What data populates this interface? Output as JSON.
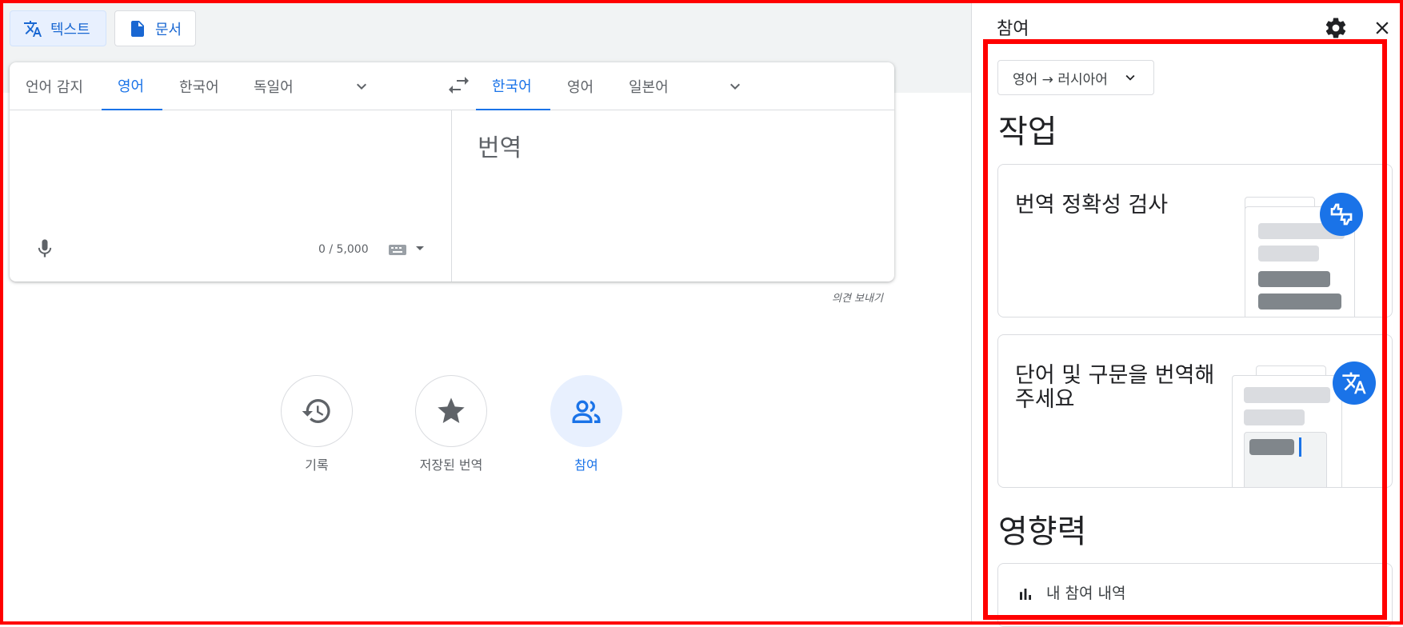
{
  "toolbar": {
    "text_mode_label": "텍스트",
    "doc_mode_label": "문서"
  },
  "source_langs": {
    "detect": "언어 감지",
    "english": "영어",
    "korean": "한국어",
    "german": "독일어"
  },
  "target_langs": {
    "korean": "한국어",
    "english": "영어",
    "japanese": "일본어"
  },
  "input": {
    "char_count": "0 / 5,000"
  },
  "output": {
    "placeholder": "번역"
  },
  "feedback_link": "의견 보내기",
  "bottom_actions": {
    "history": "기록",
    "saved": "저장된 번역",
    "contribute": "참여"
  },
  "panel": {
    "title": "참여",
    "lang_pair": "영어 → 러시아어",
    "tasks_heading": "작업",
    "task_verify": "번역 정확성 검사",
    "task_translate": "단어 및 구문을 번역해 주세요",
    "impact_heading": "영향력",
    "my_contributions": "내 참여 내역"
  },
  "colors": {
    "accent": "#1a73e8",
    "highlight_border": "#ff0000"
  },
  "icons": [
    "translate-icon",
    "document-icon",
    "chevron-down-icon",
    "swap-icon",
    "mic-icon",
    "keyboard-icon",
    "history-icon",
    "star-icon",
    "people-icon",
    "gear-icon",
    "close-icon",
    "bar-chart-icon"
  ]
}
